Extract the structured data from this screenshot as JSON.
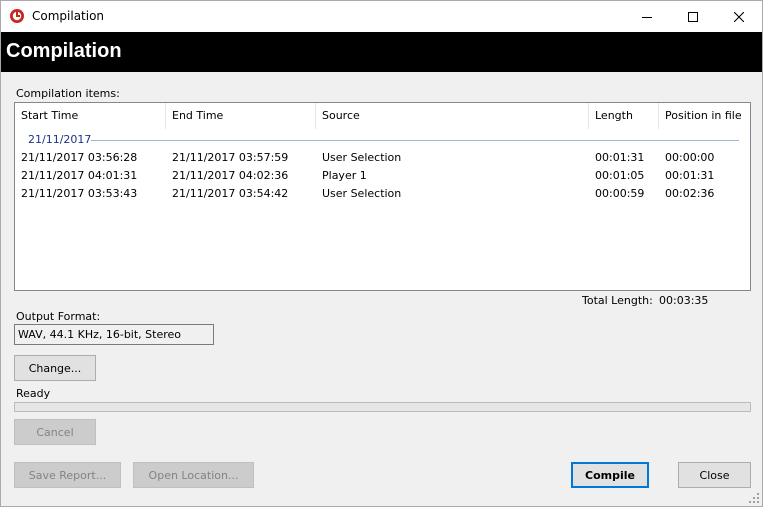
{
  "window": {
    "title": "Compilation",
    "banner_title": "Compilation"
  },
  "icons": {
    "app": "app-logo-icon",
    "minimize": "minimize-icon",
    "maximize": "maximize-icon",
    "close": "close-icon",
    "grip": "resize-grip-icon"
  },
  "items": {
    "label": "Compilation items:",
    "columns": [
      "Start Time",
      "End Time",
      "Source",
      "Length",
      "Position in file"
    ],
    "group": "21/11/2017",
    "rows": [
      [
        "21/11/2017 03:56:28",
        "21/11/2017 03:57:59",
        "User Selection",
        "00:01:31",
        "00:00:00"
      ],
      [
        "21/11/2017 04:01:31",
        "21/11/2017 04:02:36",
        "Player 1",
        "00:01:05",
        "00:01:31"
      ],
      [
        "21/11/2017 03:53:43",
        "21/11/2017 03:54:42",
        "User Selection",
        "00:00:59",
        "00:02:36"
      ]
    ]
  },
  "total": {
    "label": "Total Length:",
    "value": "00:03:35"
  },
  "output": {
    "label": "Output Format:",
    "value": "WAV, 44.1 KHz, 16-bit, Stereo",
    "change_button": "Change..."
  },
  "status": {
    "text": "Ready",
    "progress": 0,
    "cancel_button": "Cancel"
  },
  "footer": {
    "save_report": "Save Report...",
    "open_location": "Open Location...",
    "compile": "Compile",
    "close": "Close"
  },
  "colors": {
    "banner_bg": "#000000",
    "group_text": "#1e3287",
    "accent": "#0078d7"
  }
}
